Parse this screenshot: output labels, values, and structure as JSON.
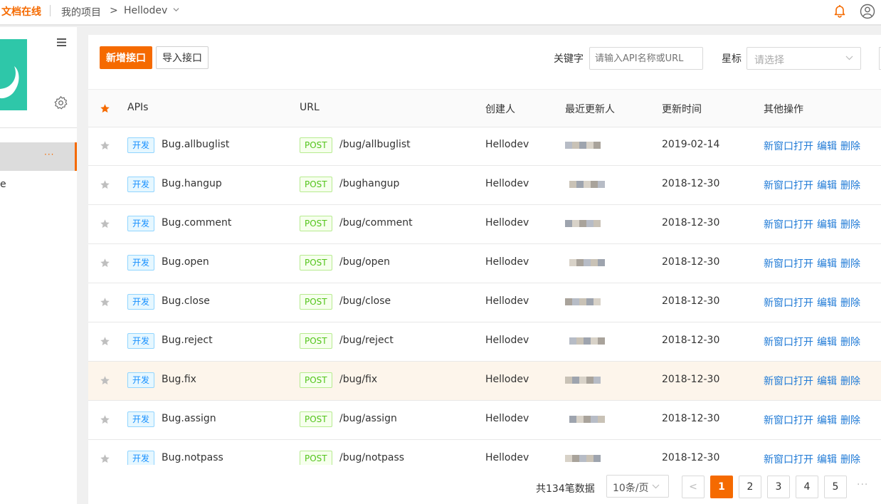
{
  "topbar": {
    "brand": "文档在线",
    "breadcrumb_project": "我的项目",
    "breadcrumb_sep": ">",
    "breadcrumb_current": "Hellodev"
  },
  "sidebar": {
    "item_text": "e",
    "item_dots": "···"
  },
  "toolbar": {
    "add_label": "新增接口",
    "import_label": "导入接口",
    "keyword_label": "关键字",
    "keyword_placeholder": "请输入API名称或URL",
    "star_label": "星标",
    "star_placeholder": "请选择"
  },
  "table": {
    "columns": [
      "APIs",
      "URL",
      "创建人",
      "最近更新人",
      "更新时间",
      "其他操作"
    ],
    "ops": [
      "新窗口打开",
      "编辑",
      "删除"
    ],
    "rows": [
      {
        "env": "开发",
        "name": "Bug.allbuglist",
        "method": "POST",
        "url": "/bug/allbuglist",
        "creator": "Hellodev",
        "updated": "2019-02-14"
      },
      {
        "env": "开发",
        "name": "Bug.hangup",
        "method": "POST",
        "url": "/bughangup",
        "creator": "Hellodev",
        "updated": "2018-12-30"
      },
      {
        "env": "开发",
        "name": "Bug.comment",
        "method": "POST",
        "url": "/bug/comment",
        "creator": "Hellodev",
        "updated": "2018-12-30"
      },
      {
        "env": "开发",
        "name": "Bug.open",
        "method": "POST",
        "url": "/bug/open",
        "creator": "Hellodev",
        "updated": "2018-12-30"
      },
      {
        "env": "开发",
        "name": "Bug.close",
        "method": "POST",
        "url": "/bug/close",
        "creator": "Hellodev",
        "updated": "2018-12-30"
      },
      {
        "env": "开发",
        "name": "Bug.reject",
        "method": "POST",
        "url": "/bug/reject",
        "creator": "Hellodev",
        "updated": "2018-12-30"
      },
      {
        "env": "开发",
        "name": "Bug.fix",
        "method": "POST",
        "url": "/bug/fix",
        "creator": "Hellodev",
        "updated": "2018-12-30",
        "highlighted": true
      },
      {
        "env": "开发",
        "name": "Bug.assign",
        "method": "POST",
        "url": "/bug/assign",
        "creator": "Hellodev",
        "updated": "2018-12-30"
      },
      {
        "env": "开发",
        "name": "Bug.notpass",
        "method": "POST",
        "url": "/bug/notpass",
        "creator": "Hellodev",
        "updated": "2018-12-30"
      }
    ]
  },
  "pagination": {
    "total_text": "共134笔数据",
    "page_size": "10条/页",
    "prev": "<",
    "pages": [
      "1",
      "2",
      "3",
      "4",
      "5"
    ],
    "current": "1",
    "more": "···"
  },
  "colors": {
    "accent": "#f56a00",
    "link": "#1f7ad6",
    "logo": "#2ec7a9"
  },
  "icons": {
    "menu": "hamburger-menu-icon",
    "settings": "gear-icon",
    "notifications": "bell-icon",
    "account": "user-icon",
    "star": "star-icon"
  }
}
